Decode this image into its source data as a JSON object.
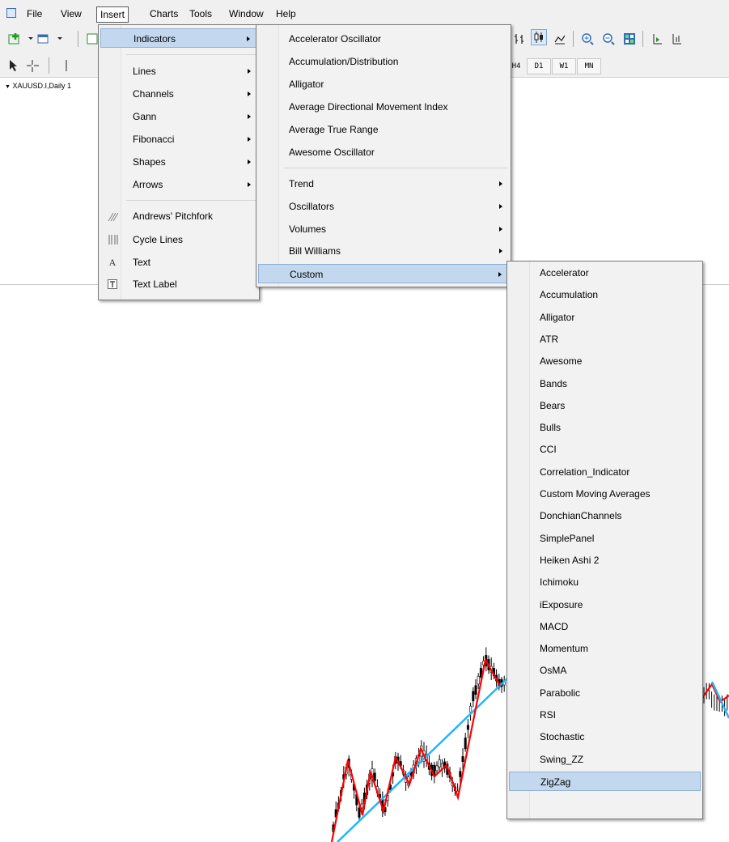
{
  "menubar": {
    "items": [
      "File",
      "View",
      "Insert",
      "Charts",
      "Tools",
      "Window",
      "Help"
    ]
  },
  "toolbar": {
    "timeframes": [
      "H4",
      "D1",
      "W1",
      "MN"
    ]
  },
  "chart": {
    "symbol_label": "XAUUSD.I,Daily  1",
    "colors": {
      "zigzag": "#ff0000",
      "trendline": "#1fb6ff",
      "candles": "#000000"
    }
  },
  "insert_menu": {
    "items": [
      {
        "label": "Indicators",
        "submenu": true,
        "highlighted": true
      },
      {
        "label": "Lines",
        "submenu": true
      },
      {
        "label": "Channels",
        "submenu": true
      },
      {
        "label": "Gann",
        "submenu": true
      },
      {
        "label": "Fibonacci",
        "submenu": true
      },
      {
        "label": "Shapes",
        "submenu": true
      },
      {
        "label": "Arrows",
        "submenu": true
      },
      {
        "label": "Andrews' Pitchfork",
        "icon": "pitchfork-icon"
      },
      {
        "label": "Cycle Lines",
        "icon": "cycle-lines-icon"
      },
      {
        "label": "Text",
        "icon": "text-icon"
      },
      {
        "label": "Text Label",
        "icon": "text-label-icon"
      }
    ]
  },
  "indicators_menu": {
    "items": [
      {
        "label": "Accelerator Oscillator"
      },
      {
        "label": "Accumulation/Distribution"
      },
      {
        "label": "Alligator"
      },
      {
        "label": "Average Directional Movement Index"
      },
      {
        "label": "Average True Range"
      },
      {
        "label": "Awesome Oscillator"
      },
      {
        "label": "Trend",
        "submenu": true
      },
      {
        "label": "Oscillators",
        "submenu": true
      },
      {
        "label": "Volumes",
        "submenu": true
      },
      {
        "label": "Bill Williams",
        "submenu": true
      },
      {
        "label": "Custom",
        "submenu": true,
        "highlighted": true
      }
    ]
  },
  "custom_menu": {
    "items": [
      {
        "label": "Accelerator"
      },
      {
        "label": "Accumulation"
      },
      {
        "label": "Alligator"
      },
      {
        "label": "ATR"
      },
      {
        "label": "Awesome"
      },
      {
        "label": "Bands"
      },
      {
        "label": "Bears"
      },
      {
        "label": "Bulls"
      },
      {
        "label": "CCI"
      },
      {
        "label": "Correlation_Indicator"
      },
      {
        "label": "Custom Moving Averages"
      },
      {
        "label": "DonchianChannels"
      },
      {
        "label": "SimplePanel"
      },
      {
        "label": "Heiken Ashi 2"
      },
      {
        "label": "Ichimoku"
      },
      {
        "label": "iExposure"
      },
      {
        "label": "MACD"
      },
      {
        "label": "Momentum"
      },
      {
        "label": "OsMA"
      },
      {
        "label": "Parabolic"
      },
      {
        "label": "RSI"
      },
      {
        "label": "Stochastic"
      },
      {
        "label": "Swing_ZZ"
      },
      {
        "label": "ZigZag",
        "highlighted": true
      }
    ]
  }
}
